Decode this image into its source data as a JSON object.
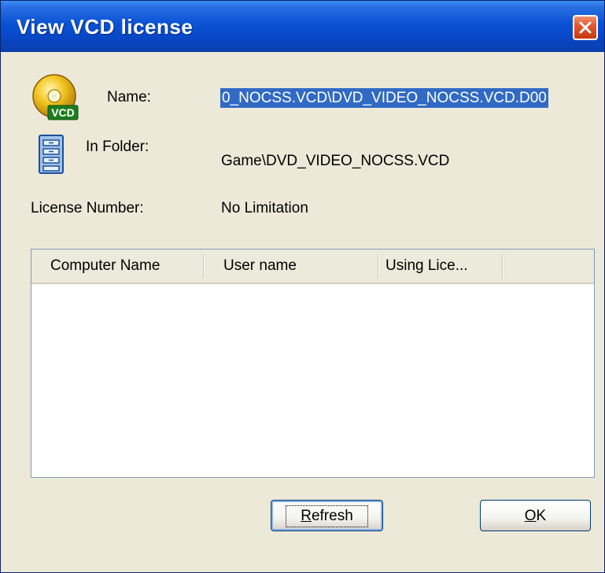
{
  "window": {
    "title": "View VCD license",
    "close_icon": "close-icon"
  },
  "fields": {
    "name_label": "Name:",
    "name_value": "0_NOCSS.VCD\\DVD_VIDEO_NOCSS.VCD.D00",
    "folder_label": "In Folder:",
    "folder_value": "Game\\DVD_VIDEO_NOCSS.VCD",
    "license_label": "License Number:",
    "license_value": "No Limitation"
  },
  "icons": {
    "vcd_disc": "vcd-disc-icon",
    "vcd_badge": "VCD",
    "folder": "file-cabinet-icon"
  },
  "list": {
    "columns": [
      "Computer Name",
      "User name",
      "Using Lice..."
    ],
    "rows": []
  },
  "buttons": {
    "refresh_accel": "R",
    "refresh_rest": "efresh",
    "ok_accel": "O",
    "ok_rest": "K"
  },
  "colors": {
    "titlebar": "#0a52d6",
    "selection": "#316ac5",
    "close": "#e45a30",
    "dialog_bg": "#ece9d8"
  }
}
